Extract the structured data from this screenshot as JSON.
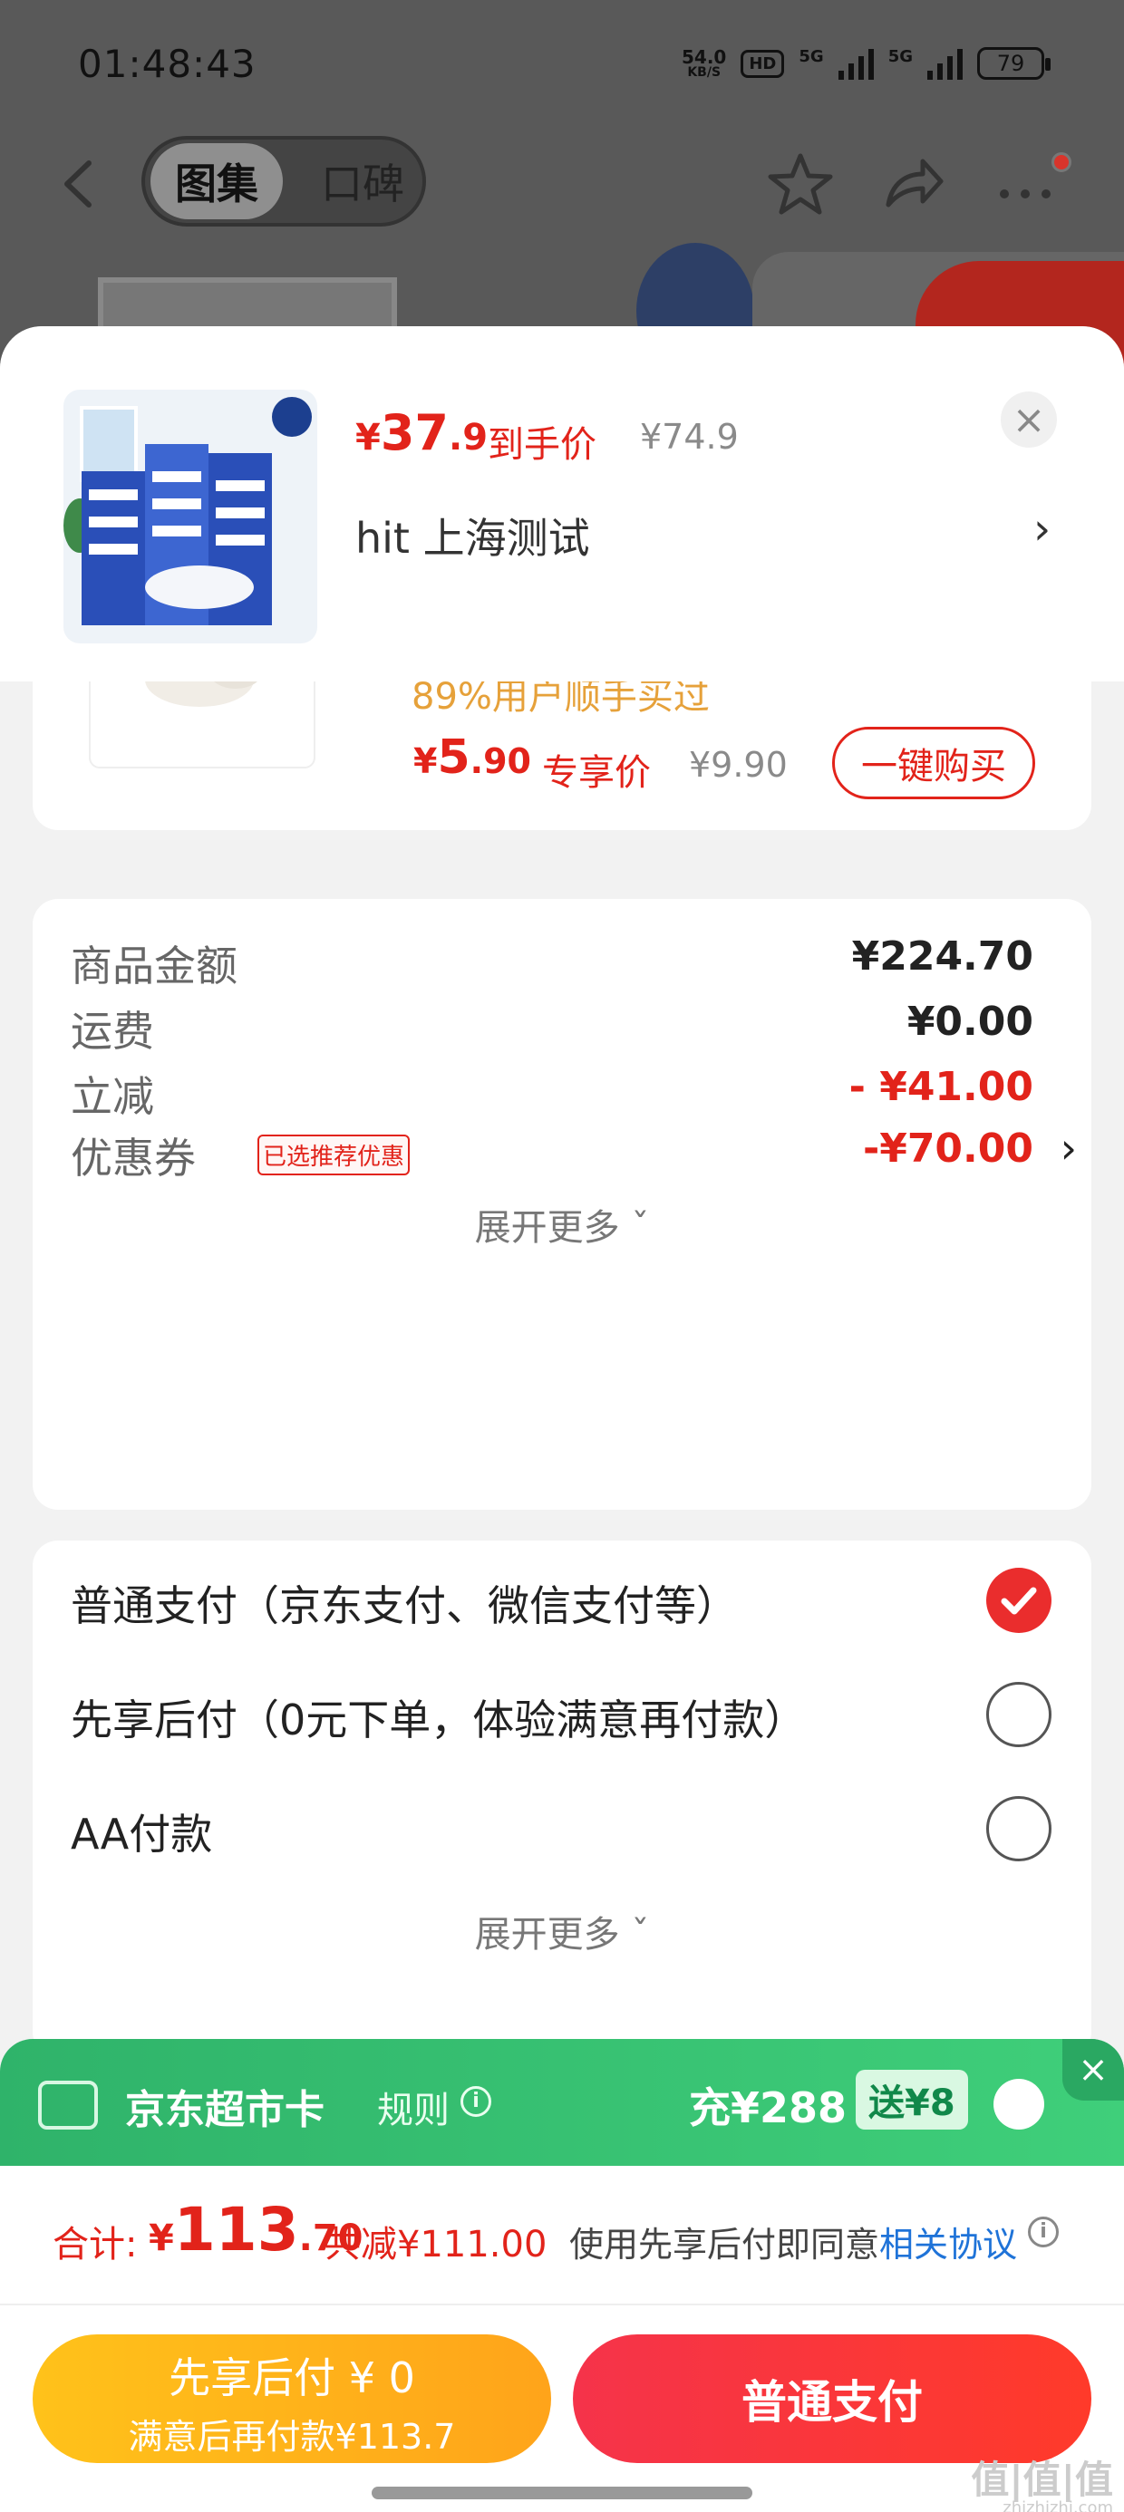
{
  "status_bar": {
    "time": "01:48:43",
    "net_speed_value": "54.0",
    "net_speed_unit": "KB/S",
    "hd_label": "HD",
    "sim1_label": "5G",
    "sim2_label": "5G",
    "battery": "79"
  },
  "nav": {
    "tab_gallery": "图集",
    "tab_reviews": "口碑"
  },
  "product": {
    "price_currency": "¥",
    "price_int": "37",
    "price_dec": ".9",
    "price_tag": "到手价",
    "original_price": "¥74.9",
    "address": "hit  上海测试",
    "chevron": "›",
    "close": "×"
  },
  "addon": {
    "note": "89%用户顺手买过",
    "price_currency": "¥",
    "price_int": "5",
    "price_dec": ".90",
    "price_tag": "专享价",
    "original_price": "¥9.90",
    "buy_label": "一键购买"
  },
  "cost": {
    "goods_label": "商品金额",
    "goods_value": "¥224.70",
    "shipping_label": "运费",
    "shipping_value": "¥0.00",
    "discount_label": "立减",
    "discount_value": "- ¥41.00",
    "coupon_label": "优惠券",
    "coupon_badge": "已选推荐优惠",
    "coupon_value": "-¥70.00",
    "coupon_chevron": "›",
    "expand_label": "展开更多 ˇ"
  },
  "payment": {
    "options": [
      {
        "label": "普通支付（京东支付、微信支付等）",
        "checked": true
      },
      {
        "label": "先享后付（0元下单，体验满意再付款）",
        "checked": false
      },
      {
        "label": "AA付款",
        "checked": false
      }
    ],
    "expand_label": "展开更多 ˇ"
  },
  "card_bar": {
    "title": "京东超市卡",
    "rule_label": "规则",
    "info": "i",
    "charge": "充¥288",
    "gift": "送¥8",
    "close": "×"
  },
  "total": {
    "label": "合计:",
    "currency": "¥",
    "int": "113",
    "dec": ".70",
    "reduce": "共减¥111.00",
    "agree_text": "使用先享后付即同意",
    "agree_link": "相关协议",
    "info": "i"
  },
  "buttons": {
    "later_line1": "先享后付 ¥ 0",
    "later_line2": "满意后再付款¥113.7",
    "normal": "普通支付"
  },
  "watermark": {
    "main": "值|值|值",
    "sub": "zhizhizhi.com"
  },
  "colors": {
    "accent_red": "#e2231a",
    "member_green": "#2fb36a",
    "pay_later_yellow": "#ffb21a",
    "link_blue": "#1f73d8"
  }
}
